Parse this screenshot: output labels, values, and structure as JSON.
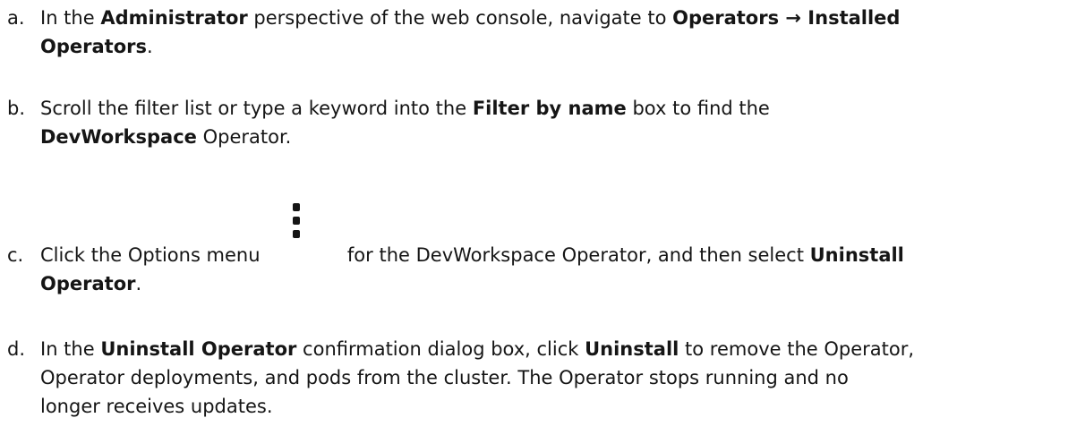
{
  "steps": [
    {
      "letter": "a.",
      "s1": "In the ",
      "b1": "Administrator",
      "s2": " perspective of the web console, navigate to  ",
      "b2": "Operators → Installed",
      "b3": "Operators",
      "s3": "."
    },
    {
      "letter": "b.",
      "s1": "Scroll the filter list or type a keyword into the ",
      "b1": "Filter by name",
      "s2": " box to find the",
      "b2": "DevWorkspace",
      "s3": " Operator."
    },
    {
      "letter": "c.",
      "s1": "Click the Options menu ",
      "s2": " for the DevWorkspace Operator, and then select ",
      "b1": "Uninstall",
      "b2": "Operator",
      "s3": ".",
      "icon": "kebab-menu-icon"
    },
    {
      "letter": "d.",
      "s1": "In the ",
      "b1": "Uninstall Operator",
      "s2": " confirmation dialog box, click  ",
      "b2": "Uninstall",
      "s3": " to remove the Operator,",
      "s4": "Operator deployments, and pods from the cluster. The Operator stops running and no",
      "s5": "longer receives updates."
    }
  ]
}
